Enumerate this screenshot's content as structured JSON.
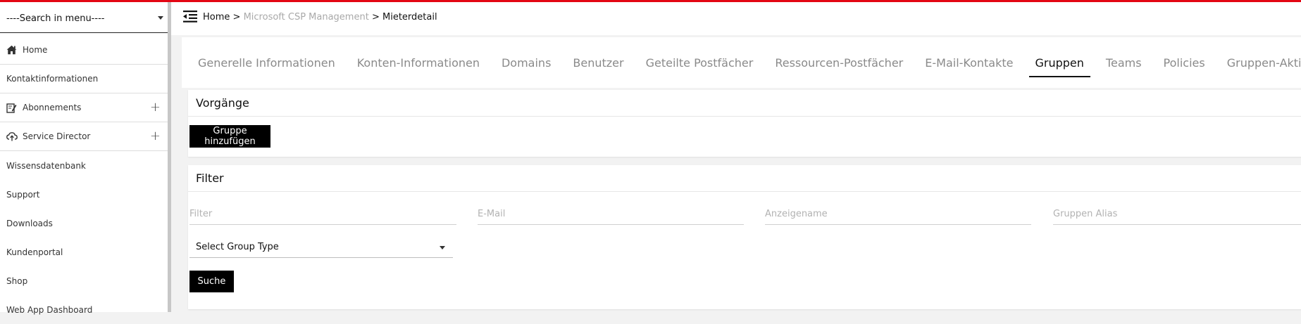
{
  "colors": {
    "accent_top": "#e30613",
    "button_bg": "#000000"
  },
  "sidebar": {
    "search_label": "----Search in menu----",
    "items": [
      {
        "label": "Home",
        "icon": "house-icon"
      },
      {
        "label": "Kontaktinformationen"
      },
      {
        "label": "Abonnements",
        "icon": "edit-icon",
        "expandable": "+"
      },
      {
        "label": "Service Director",
        "icon": "cloud-upload-icon",
        "expandable": "+"
      },
      {
        "label": "Wissensdatenbank"
      },
      {
        "label": "Support"
      },
      {
        "label": "Downloads"
      },
      {
        "label": "Kundenportal"
      },
      {
        "label": "Shop"
      },
      {
        "label": "Web App Dashboard"
      }
    ]
  },
  "header": {
    "breadcrumb": {
      "home": "Home",
      "sep": ">",
      "middle": "Microsoft CSP Management",
      "current": "Mieterdetail"
    }
  },
  "tabs": [
    {
      "label": "Generelle Informationen"
    },
    {
      "label": "Konten-Informationen"
    },
    {
      "label": "Domains"
    },
    {
      "label": "Benutzer"
    },
    {
      "label": "Geteilte Postfächer"
    },
    {
      "label": "Ressourcen-Postfächer"
    },
    {
      "label": "E-Mail-Kontakte"
    },
    {
      "label": "Gruppen",
      "active": true
    },
    {
      "label": "Teams"
    },
    {
      "label": "Policies"
    },
    {
      "label": "Gruppen-Aktionen"
    }
  ],
  "vorgaenge": {
    "title": "Vorgänge",
    "add_group_label": "Gruppe hinzufügen"
  },
  "filter": {
    "title": "Filter",
    "filter_placeholder": "Filter",
    "email_placeholder": "E-Mail",
    "display_name_placeholder": "Anzeigename",
    "group_alias_placeholder": "Gruppen Alias",
    "group_type_selected": "Select Group Type",
    "search_label": "Suche"
  }
}
